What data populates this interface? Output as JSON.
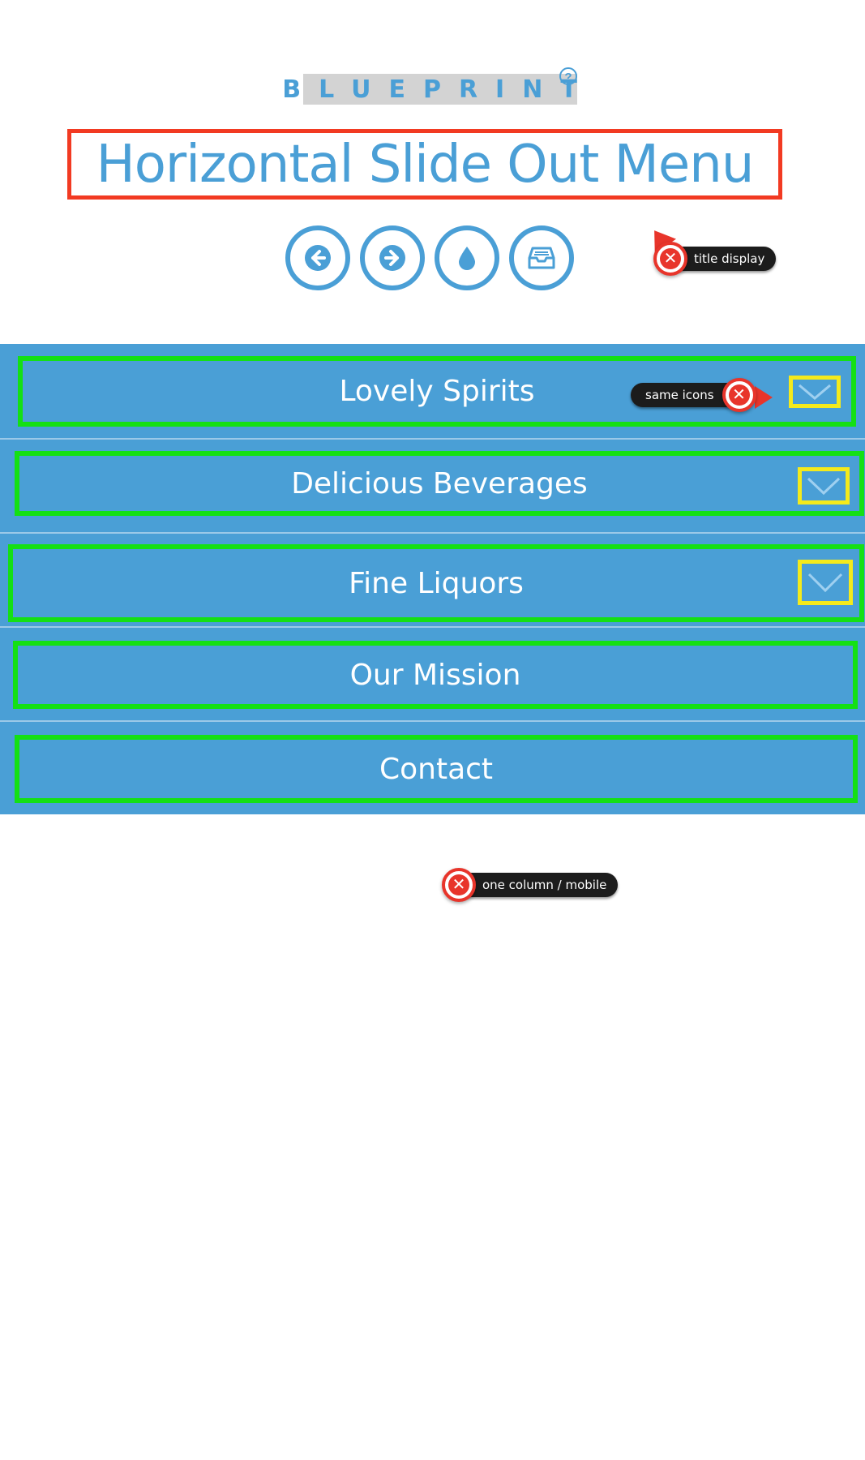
{
  "header": {
    "brand": "BLUEPRINT",
    "brand_help": "?",
    "title": "Horizontal Slide Out Menu"
  },
  "toolbar": [
    {
      "name": "previous-button",
      "icon": "arrow-left-icon"
    },
    {
      "name": "next-button",
      "icon": "arrow-right-icon"
    },
    {
      "name": "color-button",
      "icon": "water-drop-icon"
    },
    {
      "name": "archive-button",
      "icon": "inbox-tray-icon"
    }
  ],
  "menu": {
    "items": [
      {
        "label": "Lovely Spirits",
        "has_submenu": true
      },
      {
        "label": "Delicious Beverages",
        "has_submenu": true
      },
      {
        "label": "Fine Liquors",
        "has_submenu": true
      },
      {
        "label": "Our Mission",
        "has_submenu": false
      },
      {
        "label": "Contact",
        "has_submenu": false
      }
    ]
  },
  "annotations": {
    "title_display": "title display",
    "same_icons": "same icons",
    "one_column": "one column / mobile",
    "close_glyph": "✕"
  },
  "colors": {
    "accent": "#4a9fd6",
    "title_outline": "#f23a22",
    "item_outline": "#14e014",
    "icon_outline": "#f4ea1c",
    "pin_red": "#e8352b",
    "pin_dark": "#1c1c1c"
  }
}
